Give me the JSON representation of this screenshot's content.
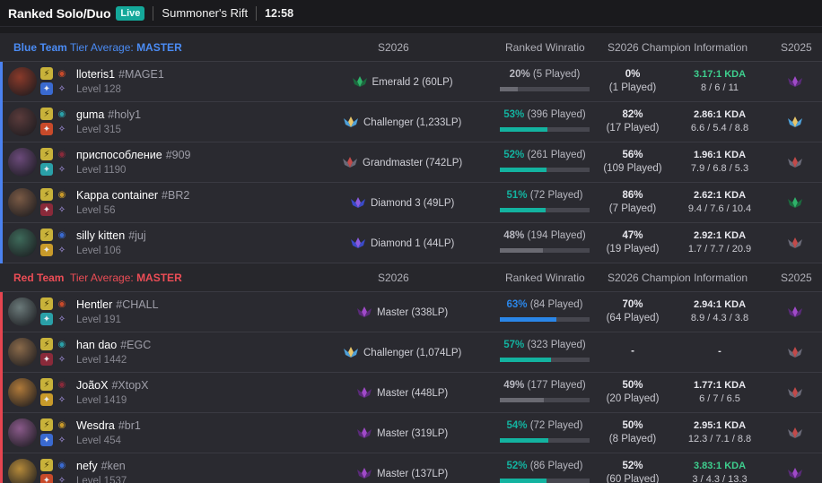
{
  "header": {
    "title": "Ranked Solo/Duo",
    "live": "Live",
    "map": "Summoner's Rift",
    "time": "12:58"
  },
  "columns": {
    "season": "S2026",
    "winratio": "Ranked Winratio",
    "champ_info": "S2026 Champion Information",
    "prev_season": "S2025"
  },
  "colors": {
    "blue_team": "#4b8cf5",
    "red_team": "#ec4d56",
    "wr_high": "#13b3a0",
    "wr_top": "#2a86e8",
    "wr_low": "#6a6a72",
    "kda_high": "#3ecf8e"
  },
  "blue_team": {
    "name": "Blue Team",
    "tier_label": "Tier Average:",
    "tier_value": "MASTER",
    "players": [
      {
        "name": "lloteris1",
        "tag": "#MAGE1",
        "level": "Level 128",
        "rank": "Emerald 2 (60LP)",
        "rank_icon": "emerald-crest-icon",
        "wr_pct": "20%",
        "wr_played": "(5 Played)",
        "wr_value": 20,
        "champ_pct": "0%",
        "champ_played": "(1 Played)",
        "kda": "3.17:1 KDA",
        "kda_detail": "8 / 6 / 11",
        "prev_icon": "master-crest-icon"
      },
      {
        "name": "guma",
        "tag": "#holy1",
        "level": "Level 315",
        "rank": "Challenger (1,233LP)",
        "rank_icon": "challenger-crest-icon",
        "wr_pct": "53%",
        "wr_played": "(396 Played)",
        "wr_value": 53,
        "champ_pct": "82%",
        "champ_played": "(17 Played)",
        "kda": "2.86:1 KDA",
        "kda_detail": "6.6 / 5.4 / 8.8",
        "prev_icon": "challenger-crest-icon"
      },
      {
        "name": "приспособление",
        "tag": "#909",
        "level": "Level 1190",
        "rank": "Grandmaster (742LP)",
        "rank_icon": "grandmaster-crest-icon",
        "wr_pct": "52%",
        "wr_played": "(261 Played)",
        "wr_value": 52,
        "champ_pct": "56%",
        "champ_played": "(109 Played)",
        "kda": "1.96:1 KDA",
        "kda_detail": "7.9 / 6.8 / 5.3",
        "prev_icon": "grandmaster-crest-icon"
      },
      {
        "name": "Kappa container",
        "tag": "#BR2",
        "level": "Level 56",
        "rank": "Diamond 3 (49LP)",
        "rank_icon": "diamond-crest-icon",
        "wr_pct": "51%",
        "wr_played": "(72 Played)",
        "wr_value": 51,
        "champ_pct": "86%",
        "champ_played": "(7 Played)",
        "kda": "2.62:1 KDA",
        "kda_detail": "9.4 / 7.6 / 10.4",
        "prev_icon": "emerald-crest-icon"
      },
      {
        "name": "silly kitten",
        "tag": "#juj",
        "level": "Level 106",
        "rank": "Diamond 1 (44LP)",
        "rank_icon": "diamond-crest-icon",
        "wr_pct": "48%",
        "wr_played": "(194 Played)",
        "wr_value": 48,
        "champ_pct": "47%",
        "champ_played": "(19 Played)",
        "kda": "2.92:1 KDA",
        "kda_detail": "1.7 / 7.7 / 20.9",
        "prev_icon": "grandmaster-crest-icon"
      }
    ]
  },
  "red_team": {
    "name": "Red Team",
    "tier_label": "Tier Average:",
    "tier_value": "MASTER",
    "players": [
      {
        "name": "Hentler",
        "tag": "#CHALL",
        "level": "Level 191",
        "rank": "Master (338LP)",
        "rank_icon": "master-crest-icon",
        "wr_pct": "63%",
        "wr_played": "(84 Played)",
        "wr_value": 63,
        "champ_pct": "70%",
        "champ_played": "(64 Played)",
        "kda": "2.94:1 KDA",
        "kda_detail": "8.9 / 4.3 / 3.8",
        "prev_icon": "master-crest-icon"
      },
      {
        "name": "han dao",
        "tag": "#EGC",
        "level": "Level 1442",
        "rank": "Challenger (1,074LP)",
        "rank_icon": "challenger-crest-icon",
        "wr_pct": "57%",
        "wr_played": "(323 Played)",
        "wr_value": 57,
        "champ_pct": "-",
        "champ_played": "",
        "kda": "-",
        "kda_detail": "",
        "prev_icon": "grandmaster-crest-icon"
      },
      {
        "name": "JoãoX",
        "tag": "#XtopX",
        "level": "Level 1419",
        "rank": "Master (448LP)",
        "rank_icon": "master-crest-icon",
        "wr_pct": "49%",
        "wr_played": "(177 Played)",
        "wr_value": 49,
        "champ_pct": "50%",
        "champ_played": "(20 Played)",
        "kda": "1.77:1 KDA",
        "kda_detail": "6 / 7 / 6.5",
        "prev_icon": "grandmaster-crest-icon"
      },
      {
        "name": "Wesdra",
        "tag": "#br1",
        "level": "Level 454",
        "rank": "Master (319LP)",
        "rank_icon": "master-crest-icon",
        "wr_pct": "54%",
        "wr_played": "(72 Played)",
        "wr_value": 54,
        "champ_pct": "50%",
        "champ_played": "(8 Played)",
        "kda": "2.95:1 KDA",
        "kda_detail": "12.3 / 7.1 / 8.8",
        "prev_icon": "grandmaster-crest-icon"
      },
      {
        "name": "nefy",
        "tag": "#ken",
        "level": "Level 1537",
        "rank": "Master (137LP)",
        "rank_icon": "master-crest-icon",
        "wr_pct": "52%",
        "wr_played": "(86 Played)",
        "wr_value": 52,
        "champ_pct": "52%",
        "champ_played": "(60 Played)",
        "kda": "3.83:1 KDA",
        "kda_detail": "3 / 4.3 / 13.3",
        "prev_icon": "master-crest-icon"
      }
    ]
  }
}
